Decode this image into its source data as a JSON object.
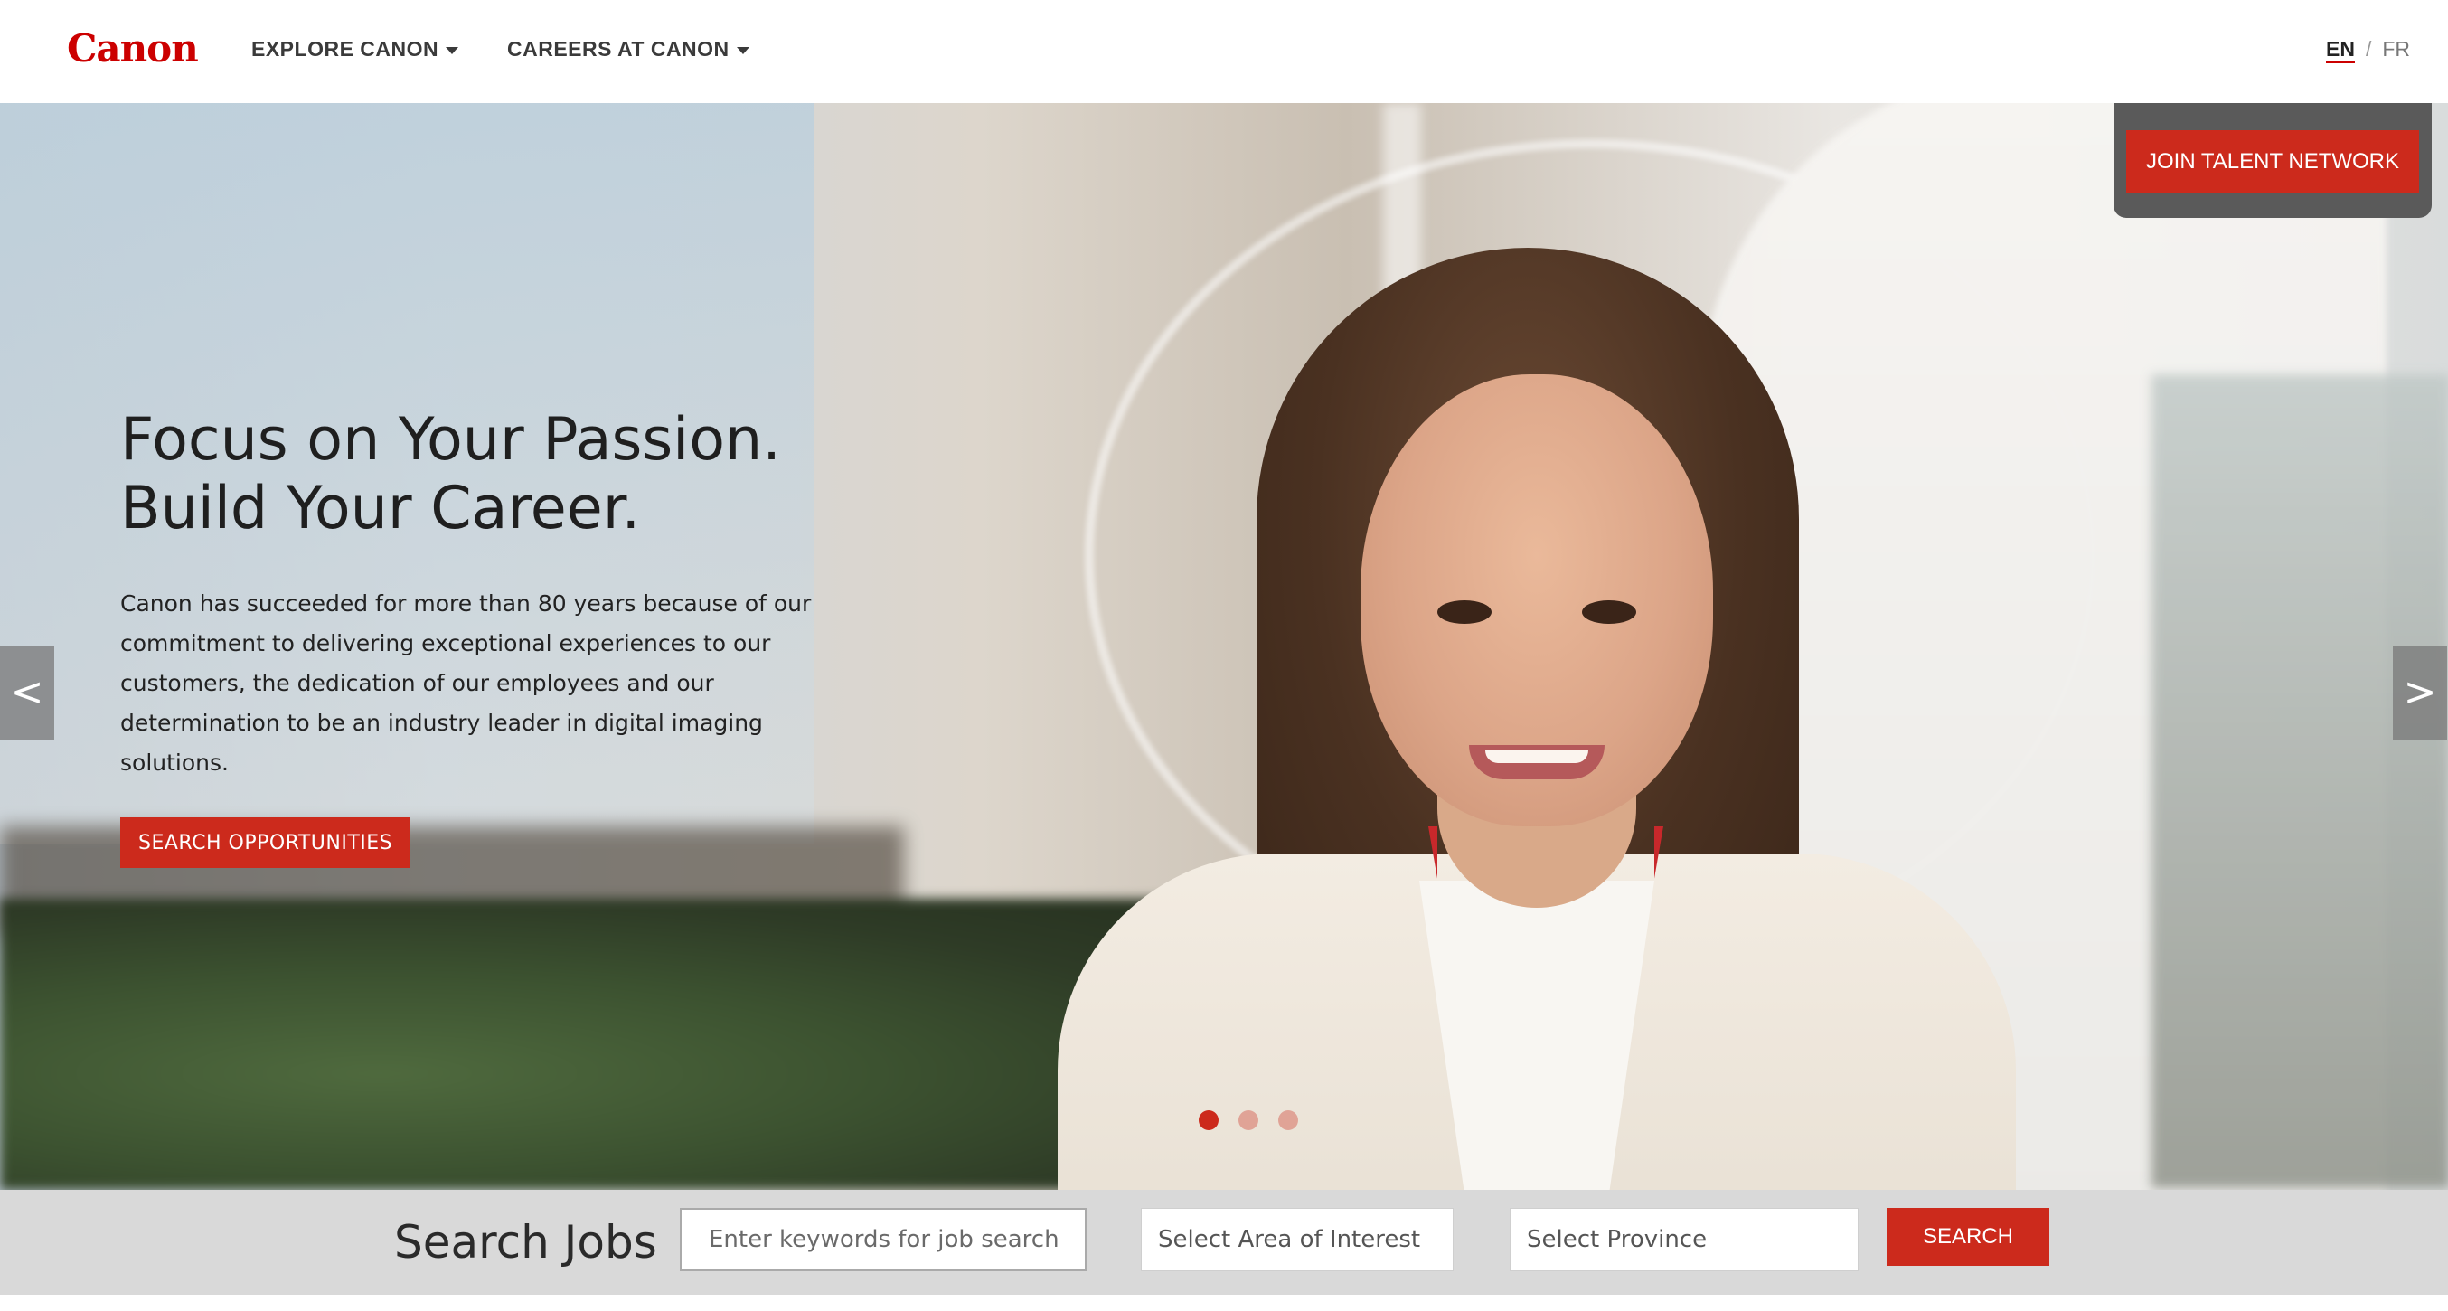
{
  "header": {
    "logo_text": "Canon",
    "nav": [
      {
        "label": "EXPLORE CANON"
      },
      {
        "label": "CAREERS AT CANON"
      }
    ],
    "lang": {
      "en": "EN",
      "sep": "/",
      "fr": "FR"
    }
  },
  "hero": {
    "title": "Focus on Your Passion.\nBuild Your Career.",
    "body": "Canon has succeeded for more than 80 years because of our commitment to delivering exceptional experiences to our customers, the dedication of our employees and our determination to be an industry leader in digital imaging solutions.",
    "cta_label": "SEARCH OPPORTUNITIES",
    "prev_label": "<",
    "next_label": ">",
    "slides": 3,
    "active_slide": 1,
    "talent_label": "JOIN TALENT NETWORK"
  },
  "search": {
    "label": "Search Jobs",
    "keywords_placeholder": "Enter keywords for job search",
    "area_value": "Select Area of Interest",
    "province_value": "Select Province",
    "button_label": "SEARCH"
  },
  "colors": {
    "brand_red": "#cc2a1c",
    "logo_red": "#cc0000",
    "search_bar_bg": "#d9d9d9",
    "talent_tab_bg": "#5a5a5a"
  }
}
